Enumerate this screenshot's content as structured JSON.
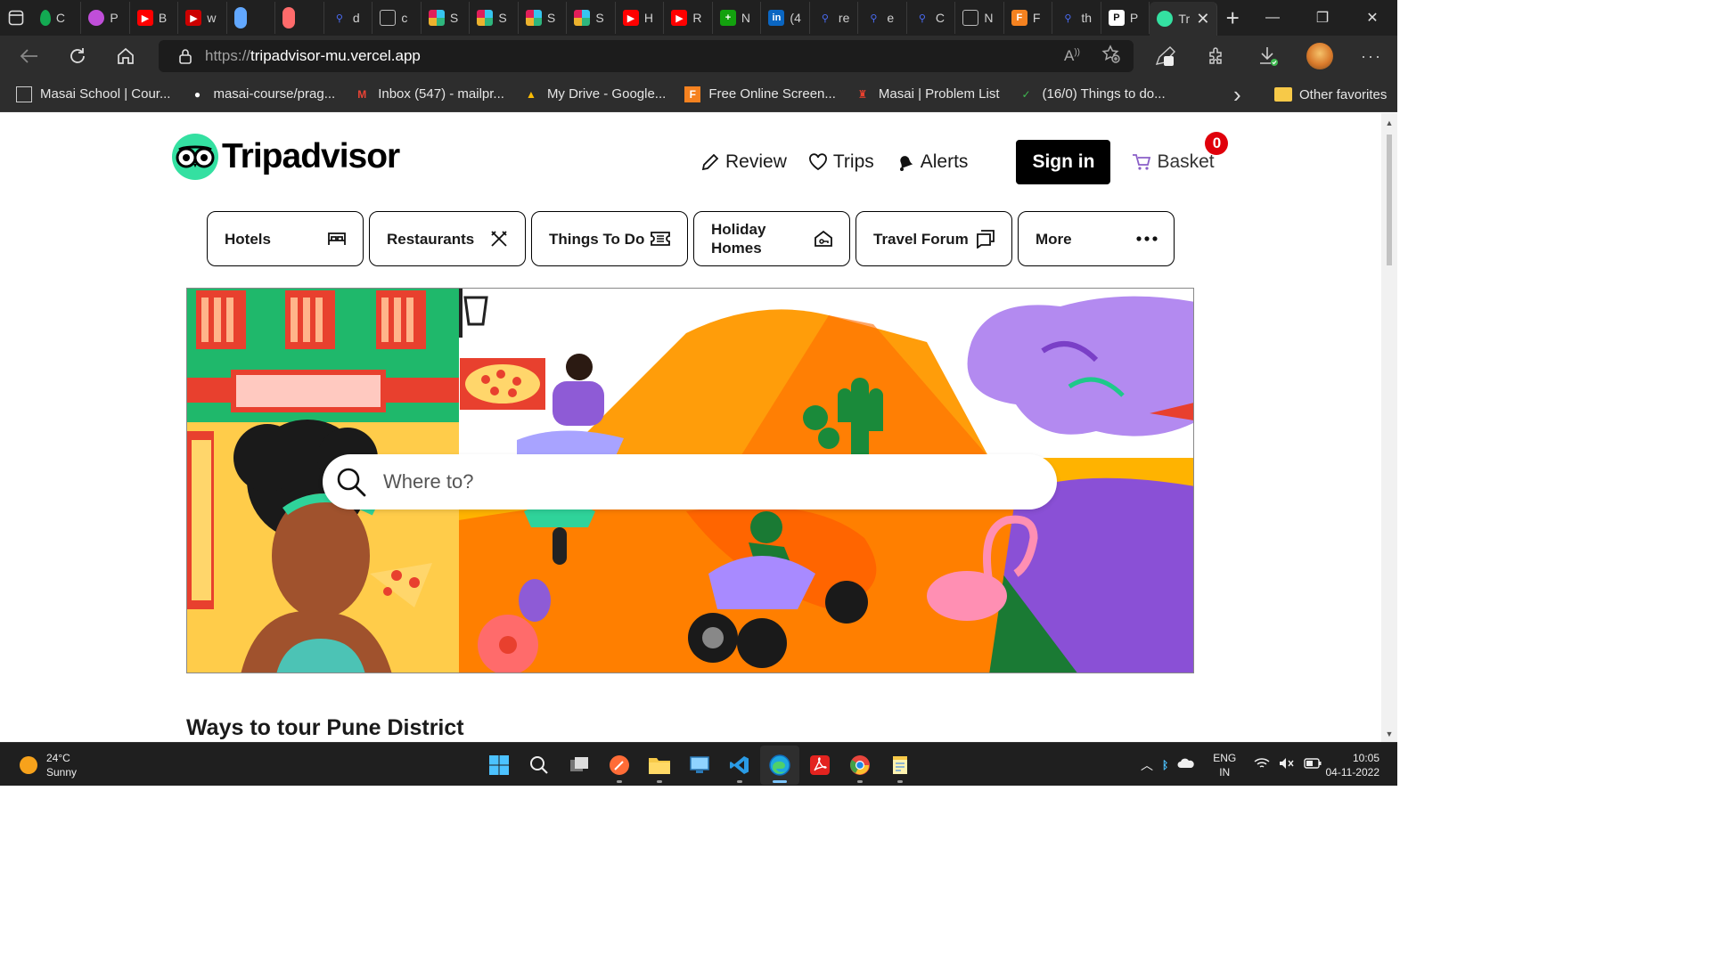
{
  "browser": {
    "tabs": [
      {
        "title": "C",
        "icon": "mongodb-icon",
        "color": "#13aa52"
      },
      {
        "title": "P",
        "icon": "app-icon",
        "color": "#c04ed9"
      },
      {
        "title": "B",
        "icon": "youtube-icon",
        "color": "#ff0000"
      },
      {
        "title": "w",
        "icon": "youtube-icon",
        "color": "#cc0000"
      },
      {
        "title": "",
        "icon": "pill-icon",
        "color": "#62a8ff"
      },
      {
        "title": "",
        "icon": "pill-icon",
        "color": "#ff6b6b"
      },
      {
        "title": "d",
        "icon": "search-icon",
        "color": "#4a6cf7"
      },
      {
        "title": "c",
        "icon": "page-icon",
        "color": "#888888"
      },
      {
        "title": "S",
        "icon": "slack-icon",
        "color": "#36c5f0"
      },
      {
        "title": "S",
        "icon": "slack-icon",
        "color": "#36c5f0"
      },
      {
        "title": "S",
        "icon": "slack-icon",
        "color": "#36c5f0"
      },
      {
        "title": "S",
        "icon": "slack-icon",
        "color": "#36c5f0"
      },
      {
        "title": "H",
        "icon": "youtube-icon",
        "color": "#ff0000"
      },
      {
        "title": "R",
        "icon": "youtube-icon",
        "color": "#ff0000"
      },
      {
        "title": "N",
        "icon": "plus-icon",
        "color": "#13a10e"
      },
      {
        "title": "(4",
        "icon": "linkedin-icon",
        "color": "#0a66c2"
      },
      {
        "title": "re",
        "icon": "search-icon",
        "color": "#4a6cf7"
      },
      {
        "title": "e",
        "icon": "search-icon",
        "color": "#4a6cf7"
      },
      {
        "title": "C",
        "icon": "search-icon",
        "color": "#4a6cf7"
      },
      {
        "title": "N",
        "icon": "page-icon",
        "color": "#888888"
      },
      {
        "title": "F",
        "icon": "f-icon",
        "color": "#f58220"
      },
      {
        "title": "th",
        "icon": "search-icon",
        "color": "#4a6cf7"
      },
      {
        "title": "P",
        "icon": "p-icon",
        "color": "#ffffff"
      }
    ],
    "active_tab": {
      "title": "Tr",
      "icon": "tripadvisor-icon"
    },
    "url_protocol": "https://",
    "url_host": "tripadvisor-mu.vercel.app",
    "bookmarks": [
      {
        "label": "Masai School | Cour...",
        "icon": "page-icon"
      },
      {
        "label": "masai-course/prag...",
        "icon": "github-icon"
      },
      {
        "label": "Inbox (547) - mailpr...",
        "icon": "gmail-icon"
      },
      {
        "label": "My Drive - Google...",
        "icon": "drive-icon"
      },
      {
        "label": "Free Online Screen...",
        "icon": "f-icon"
      },
      {
        "label": "Masai | Problem List",
        "icon": "masai-icon"
      },
      {
        "label": "(16/0) Things to do...",
        "icon": "check-icon"
      }
    ],
    "other_favorites": "Other favorites"
  },
  "page": {
    "brand": "Tripadvisor",
    "nav": {
      "review": "Review",
      "trips": "Trips",
      "alerts": "Alerts",
      "signin": "Sign in",
      "basket": "Basket",
      "basket_count": "0"
    },
    "categories": [
      {
        "label": "Hotels",
        "icon": "bed-icon"
      },
      {
        "label": "Restaurants",
        "icon": "fork-knife-icon"
      },
      {
        "label": "Things To Do",
        "icon": "ticket-icon"
      },
      {
        "label": "Holiday Homes",
        "icon": "house-icon"
      },
      {
        "label": "Travel Forum",
        "icon": "forum-icon"
      },
      {
        "label": "More",
        "icon": "more-icon"
      }
    ],
    "search": {
      "placeholder": "Where to?"
    },
    "section_title": "Ways to tour Pune District"
  },
  "taskbar": {
    "weather_temp": "24°C",
    "weather_desc": "Sunny",
    "apps": [
      "windows-start-icon",
      "search-icon",
      "task-view-icon",
      "postman-icon",
      "file-explorer-icon",
      "remote-desktop-icon",
      "vscode-icon",
      "edge-icon",
      "acrobat-icon",
      "chrome-icon",
      "notepad-icon"
    ],
    "lang_1": "ENG",
    "lang_2": "IN",
    "time": "10:05",
    "date": "04-11-2022"
  },
  "colors": {
    "tripadvisor_green": "#34e0a1",
    "signin_bg": "#000000",
    "badge_red": "#e0000b"
  }
}
